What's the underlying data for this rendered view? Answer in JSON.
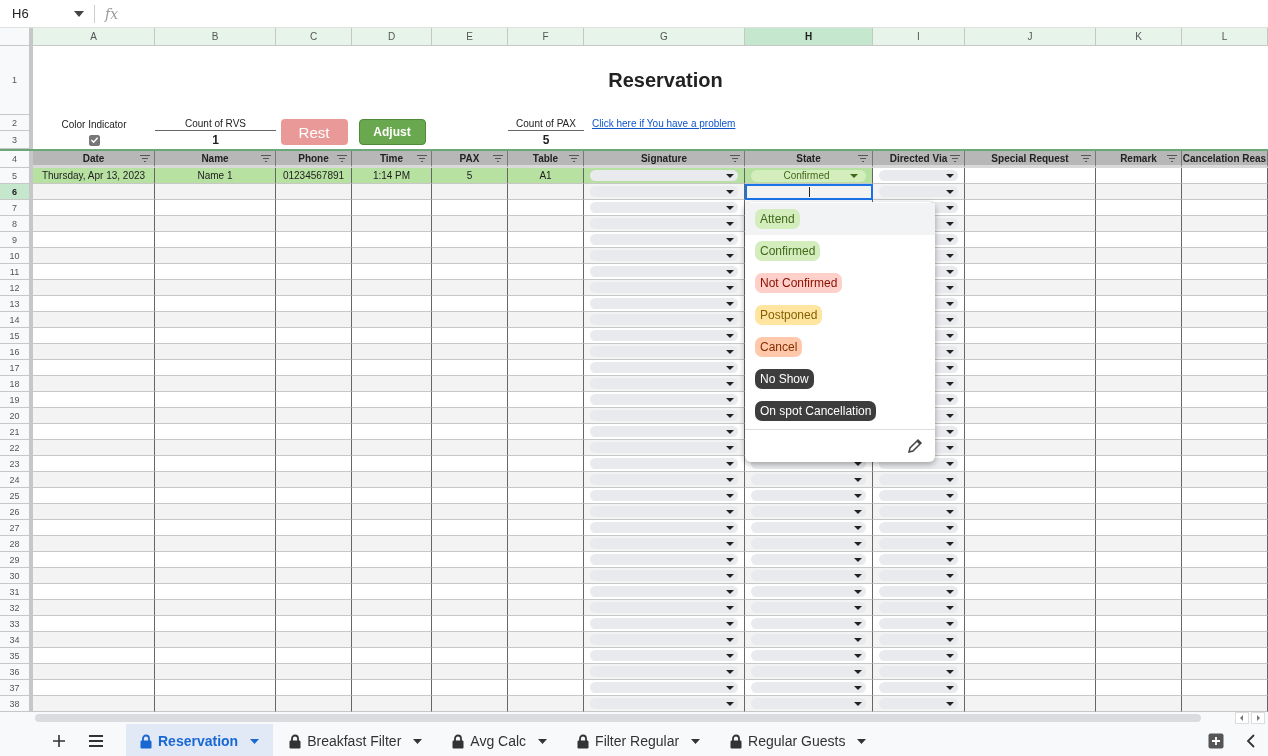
{
  "formula_bar": {
    "cell_ref": "H6",
    "fx": "fx"
  },
  "columns": [
    {
      "letter": "A",
      "selected": false
    },
    {
      "letter": "B",
      "selected": false
    },
    {
      "letter": "C",
      "selected": false
    },
    {
      "letter": "D",
      "selected": false
    },
    {
      "letter": "E",
      "selected": false
    },
    {
      "letter": "F",
      "selected": false
    },
    {
      "letter": "G",
      "selected": false
    },
    {
      "letter": "H",
      "selected": true
    },
    {
      "letter": "I",
      "selected": false
    },
    {
      "letter": "J",
      "selected": false
    },
    {
      "letter": "K",
      "selected": false
    },
    {
      "letter": "L",
      "selected": false
    }
  ],
  "top_row_numbers": [
    "1",
    "2",
    "3"
  ],
  "title": "Reservation",
  "controls": {
    "color_indicator": {
      "label": "Color Indicator",
      "checked": true
    },
    "count_rvs": {
      "label": "Count of RVS",
      "value": "1"
    },
    "rest_button": "Rest",
    "adjust_button": "Adjust",
    "count_pax": {
      "label": "Count of PAX",
      "value": "5"
    },
    "problem_link": "Click here if You have a problem"
  },
  "header_row": {
    "number": "4",
    "headers": [
      "Date",
      "Name",
      "Phone",
      "Time",
      "PAX",
      "Table",
      "Signature",
      "State",
      "Directed Via",
      "Special Request",
      "Remark",
      "Cancelation Reas"
    ]
  },
  "rows": [
    {
      "number": "5",
      "selected": false,
      "color": "#b7e1a1",
      "cells": [
        "Thursday, Apr 13, 2023",
        "Name 1",
        "01234567891",
        "1:14 PM",
        "5",
        "A1"
      ],
      "state": {
        "label": "Confirmed",
        "color": "#d4edbc"
      }
    },
    {
      "number": "6",
      "selected": true
    },
    {
      "number": "7",
      "selected": false
    },
    {
      "number": "8",
      "selected": false
    },
    {
      "number": "9",
      "selected": false
    },
    {
      "number": "10",
      "selected": false
    },
    {
      "number": "11",
      "selected": false
    },
    {
      "number": "12",
      "selected": false
    },
    {
      "number": "13",
      "selected": false
    },
    {
      "number": "14",
      "selected": false
    },
    {
      "number": "15",
      "selected": false
    },
    {
      "number": "16",
      "selected": false
    },
    {
      "number": "17",
      "selected": false
    },
    {
      "number": "18",
      "selected": false
    },
    {
      "number": "19",
      "selected": false
    },
    {
      "number": "20",
      "selected": false
    },
    {
      "number": "21",
      "selected": false
    },
    {
      "number": "22",
      "selected": false
    },
    {
      "number": "23",
      "selected": false
    },
    {
      "number": "24",
      "selected": false
    },
    {
      "number": "25",
      "selected": false
    },
    {
      "number": "26",
      "selected": false
    },
    {
      "number": "27",
      "selected": false
    },
    {
      "number": "28",
      "selected": false
    },
    {
      "number": "29",
      "selected": false
    },
    {
      "number": "30",
      "selected": false
    },
    {
      "number": "31",
      "selected": false
    },
    {
      "number": "32",
      "selected": false
    },
    {
      "number": "33",
      "selected": false
    },
    {
      "number": "34",
      "selected": false
    },
    {
      "number": "35",
      "selected": false
    },
    {
      "number": "36",
      "selected": false
    },
    {
      "number": "37",
      "selected": false
    },
    {
      "number": "38",
      "selected": false
    }
  ],
  "dropdown_menu": {
    "options": [
      {
        "label": "Attend",
        "color": "#d4edbc",
        "selected": true
      },
      {
        "label": "Confirmed",
        "color": "#d4edbc",
        "selected": false
      },
      {
        "label": "Not Confirmed",
        "color": "#ffcfc9",
        "selected": false
      },
      {
        "label": "Postponed",
        "color": "#ffe5a0",
        "selected": false
      },
      {
        "label": "Cancel",
        "color": "#ffc8aa",
        "selected": false
      },
      {
        "label": "No Show",
        "color": "#3d3d3d",
        "selected": false
      },
      {
        "label": "On spot Cancellation",
        "color": "#3d3d3d",
        "selected": false
      }
    ]
  },
  "sheet_tabs": [
    {
      "label": "Reservation",
      "selected": true
    },
    {
      "label": "Breakfast Filter",
      "selected": false
    },
    {
      "label": "Avg Calc",
      "selected": false
    },
    {
      "label": "Filter Regular",
      "selected": false
    },
    {
      "label": "Regular Guests",
      "selected": false
    }
  ]
}
